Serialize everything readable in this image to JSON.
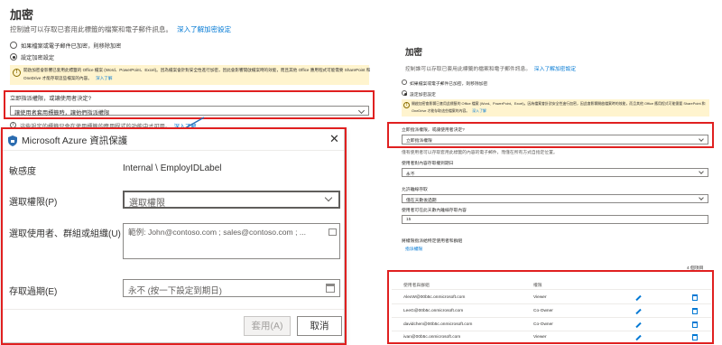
{
  "left": {
    "title": "加密",
    "description": "控制誰可以存取已套用此標籤的檔案和電子郵件訊息。",
    "description_link": "深入了解加密設定",
    "radio_remove": "如果檔案或電子郵件已加密，則移除加密",
    "radio_configure": "設定加密設定",
    "warn_text_1": "開啟加密會影響已套用此標籤的 Office 檔案 (Word、PowerPoint、Excel)。因為檔案會針對安全性進行加密，因此會影響開啟檔案時的效能，而且其他 Office 應用程式可能需要 SharePoint 和",
    "warn_text_2": "OneDrive 才能存取這些檔案的內容。",
    "warn_link": "深入了解",
    "assign_label": "立即指派權限，或讓使用者決定?",
    "assign_value": "讓使用者套用標籤時，讓他們指派權限",
    "info_text": "這些設定的標籤只會在使用標籤的應用程式的功能中才可用。",
    "info_link": "深入了解"
  },
  "dialog": {
    "title": "Microsoft Azure 資訊保護",
    "sensitivity_label": "敏感度",
    "sensitivity_value": "Internal \\ EmployIDLabel",
    "permission_label": "選取權限(P)",
    "permission_value": "選取權限",
    "users_label": "選取使用者、群組或組織(U)",
    "users_placeholder": "範例: John@contoso.com ; sales@contoso.com ; ...",
    "expiry_label": "存取過期(E)",
    "expiry_placeholder": "永不 (按一下設定到期日)",
    "apply_label": "套用(A)",
    "cancel_label": "取消"
  },
  "right": {
    "title": "加密",
    "description": "控制誰可以存取已套用此標籤的檔案和電子郵件訊息。",
    "description_link": "深入了解加密設定",
    "radio_remove": "如果檔案或電子郵件已加密，則移除加密",
    "radio_configure": "設定加密設定",
    "warn_text_1": "開啟加密會影響已套用此標籤的 Office 檔案 (Word、PowerPoint、Excel)。因為檔案會針對安全性進行加密，因此會影響開啟檔案時的效能，而且其他 Office 應用程式可能需要 SharePoint 和",
    "warn_text_2": "OneDrive 才能存取這些檔案的內容。",
    "warn_link": "深入了解",
    "assign_label": "立即指派權限，或讓使用者決定?",
    "assign_value": "立即指派權限",
    "assign_hint": "僅有使用者可以存取套用此標籤的內容的電子郵件，而僅在所有方式自指定位置。",
    "expire_label": "使用者對內容存取權到期日",
    "expire_value": "永不",
    "offline_label": "允許離線存取",
    "offline_value": "僅在天數後過期",
    "offline_days_label": "使用者可在此天數內離線存取內容",
    "offline_days_value": "15",
    "assign_perm_label": "將權限指派給特定使用者和群組",
    "assign_perm_link": "指派權限",
    "count_text": "4 個項目",
    "col_user": "使用者與群組",
    "col_perm": "權限",
    "rows": [
      {
        "user": "AlexW@00b5c.onmicrosoft.com",
        "perm": "Viewer"
      },
      {
        "user": "LeeG@00b5c.onmicrosoft.com",
        "perm": "Co-Owner"
      },
      {
        "user": "davidchen@00b5c.onmicrosoft.com",
        "perm": "Co-Owner"
      },
      {
        "user": "ivan@00b5c.onmicrosoft.com",
        "perm": "Viewer"
      }
    ]
  },
  "colors": {
    "highlight": "#e02020",
    "link": "#0078d4",
    "warning_bg": "#fff4ce"
  }
}
